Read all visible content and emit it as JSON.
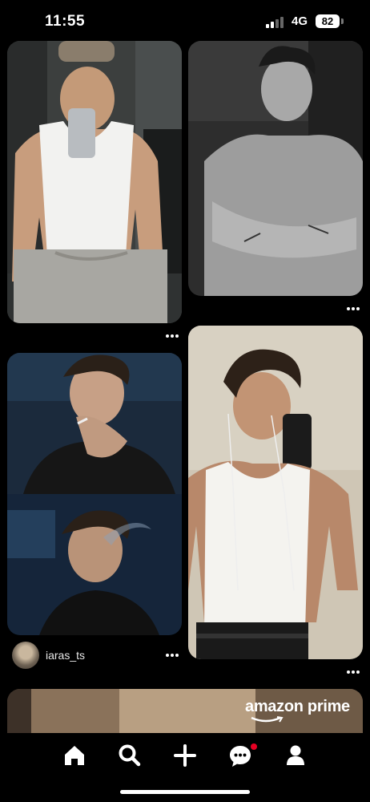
{
  "status_bar": {
    "time": "11:55",
    "network": "4G",
    "battery": "82"
  },
  "pins": [
    {
      "name": "pin-gym-mirror-selfie",
      "has_more_menu": true
    },
    {
      "name": "pin-bw-portrait",
      "has_more_menu": true
    },
    {
      "name": "pin-smoking-portraits",
      "has_more_menu": true,
      "creator": "iaras_ts"
    },
    {
      "name": "pin-mirror-selfie-tank-top",
      "has_more_menu": true
    }
  ],
  "ad": {
    "brand": "amazon prime"
  },
  "nav": {
    "items": [
      {
        "icon": "home-icon",
        "active": true
      },
      {
        "icon": "search-icon",
        "active": false
      },
      {
        "icon": "plus-icon",
        "active": false
      },
      {
        "icon": "chat-icon",
        "active": false,
        "notification": true
      },
      {
        "icon": "profile-icon",
        "active": false
      }
    ]
  },
  "colors": {
    "background": "#000000",
    "notification": "#e60023"
  }
}
